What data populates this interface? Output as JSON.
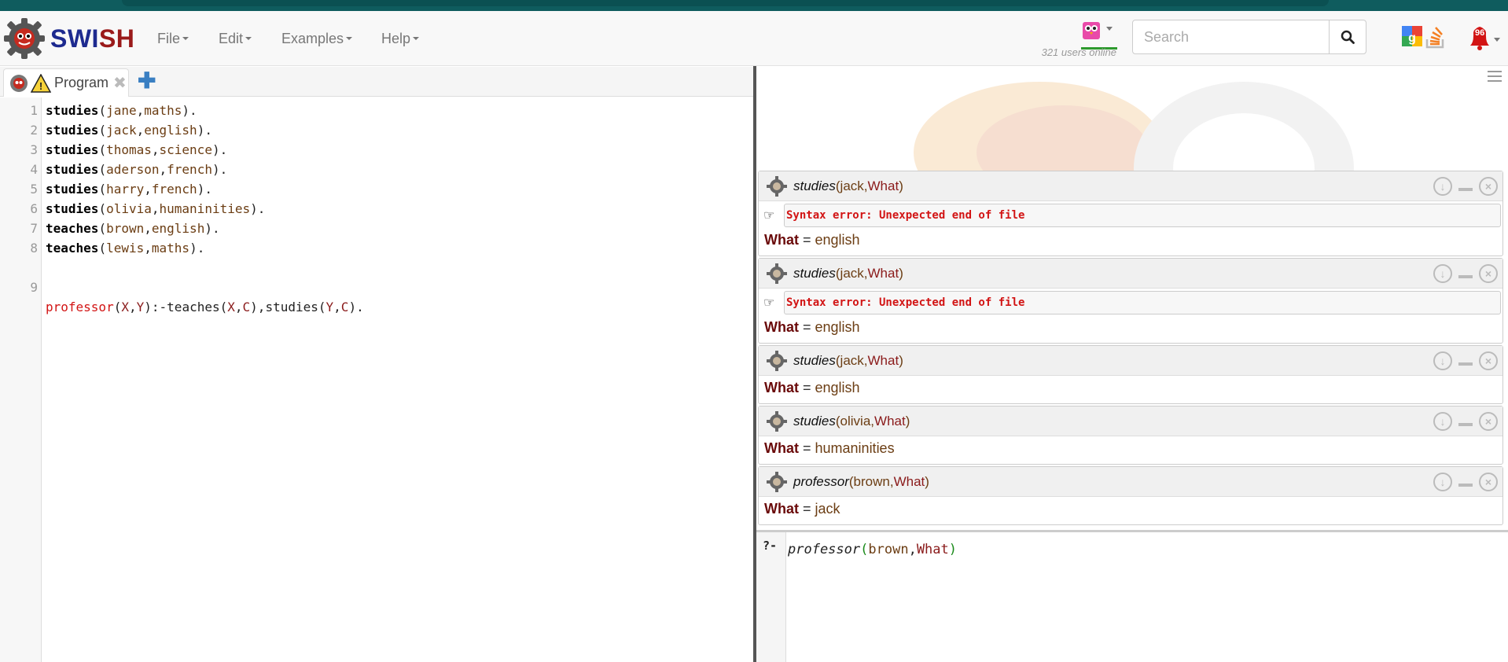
{
  "app": {
    "logo_text_sw": "SWI",
    "logo_text_sh": "SH"
  },
  "navbar": {
    "menus": [
      "File",
      "Edit",
      "Examples",
      "Help"
    ],
    "users_online": "321 users online",
    "search_placeholder": "Search",
    "notification_count": "96"
  },
  "editor": {
    "tab_label": "Program",
    "lines": [
      {
        "n": "1",
        "name": "studies",
        "args": [
          "jane",
          "maths"
        ]
      },
      {
        "n": "2",
        "name": "studies",
        "args": [
          "jack",
          "english"
        ]
      },
      {
        "n": "3",
        "name": "studies",
        "args": [
          "thomas",
          "science"
        ]
      },
      {
        "n": "4",
        "name": "studies",
        "args": [
          "aderson",
          "french"
        ]
      },
      {
        "n": "5",
        "name": "studies",
        "args": [
          "harry",
          "french"
        ]
      },
      {
        "n": "6",
        "name": "studies",
        "args": [
          "olivia",
          "humaninities"
        ]
      },
      {
        "n": "7",
        "name": "teaches",
        "args": [
          "brown",
          "english"
        ]
      },
      {
        "n": "8",
        "name": "teaches",
        "args": [
          "lewis",
          "maths"
        ]
      }
    ],
    "rule_line": {
      "n": "9",
      "head": "professor",
      "head_args": [
        "X",
        "Y"
      ],
      "neck": ":-",
      "body1": "teaches",
      "body1_args": [
        "X",
        "C"
      ],
      "body2": "studies",
      "body2_args": [
        "Y",
        "C"
      ]
    }
  },
  "answers": [
    {
      "fn": "studies",
      "arg1": "jack",
      "arg2": "What",
      "error": "Syntax error: Unexpected end of file",
      "var": "What",
      "value": "english"
    },
    {
      "fn": "studies",
      "arg1": "jack",
      "arg2": "What",
      "error": "Syntax error: Unexpected end of file",
      "var": "What",
      "value": "english"
    },
    {
      "fn": "studies",
      "arg1": "jack",
      "arg2": "What",
      "error": "",
      "var": "What",
      "value": "english"
    },
    {
      "fn": "studies",
      "arg1": "olivia",
      "arg2": "What",
      "error": "",
      "var": "What",
      "value": "humaninities"
    },
    {
      "fn": "professor",
      "arg1": "brown",
      "arg2": "What",
      "error": "",
      "var": "What",
      "value": "jack"
    }
  ],
  "query": {
    "prompt": "?-",
    "fn": "professor",
    "arg1": "brown",
    "arg2": "What"
  }
}
